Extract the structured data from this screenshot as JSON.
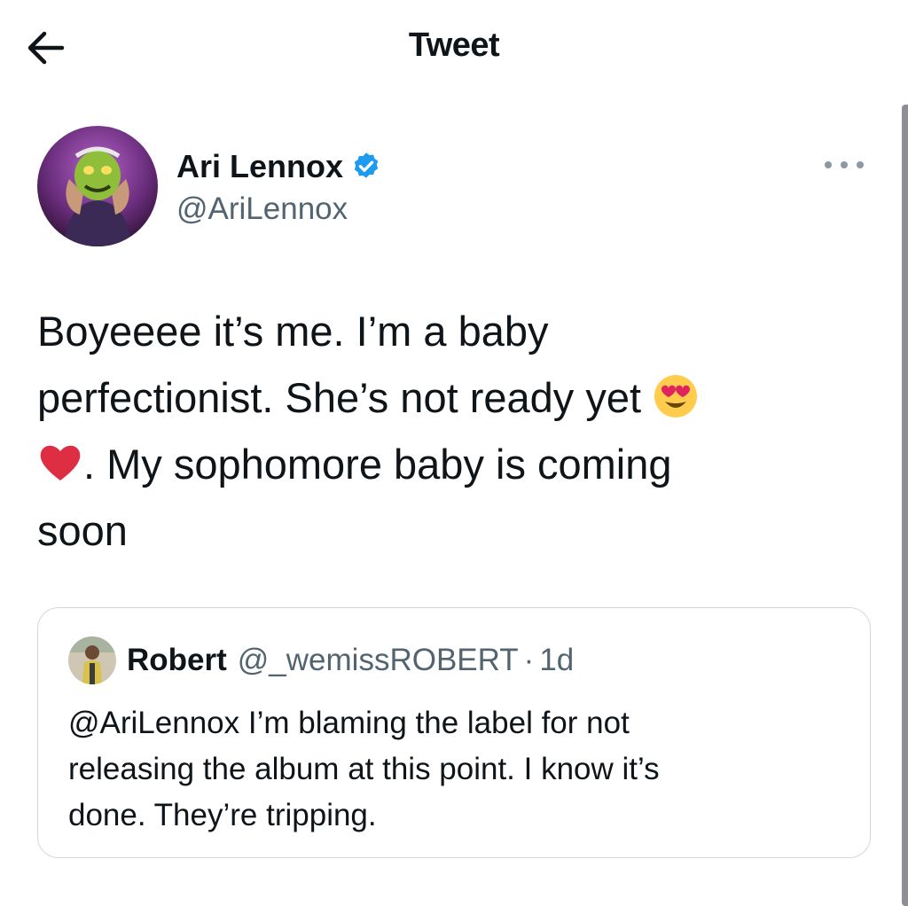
{
  "header": {
    "title": "Tweet",
    "back_icon": "arrow-left-icon"
  },
  "tweet": {
    "author": {
      "display_name": "Ari Lennox",
      "handle": "@AriLennox",
      "verified": true,
      "verified_color": "#1d9bf0"
    },
    "more_icon": "more-horizontal-icon",
    "text_lines": [
      "Boyeeee it’s me. I’m a baby",
      "perfectionist. She’s not ready yet",
      ". My sophomore baby is coming",
      "soon"
    ],
    "emojis": [
      "smiling-face-with-heart-eyes-emoji",
      "red-heart-emoji"
    ]
  },
  "quoted_tweet": {
    "display_name": "Robert",
    "handle": "@_wemissROBERT",
    "separator": "·",
    "time": "1d",
    "text_lines": [
      "@AriLennox I’m blaming the label for not",
      "releasing the album at this point. I know it’s",
      "done. They’re tripping."
    ]
  },
  "colors": {
    "text": "#0f1419",
    "secondary_text": "#536471",
    "border": "#cfd9de",
    "accent": "#1d9bf0"
  }
}
